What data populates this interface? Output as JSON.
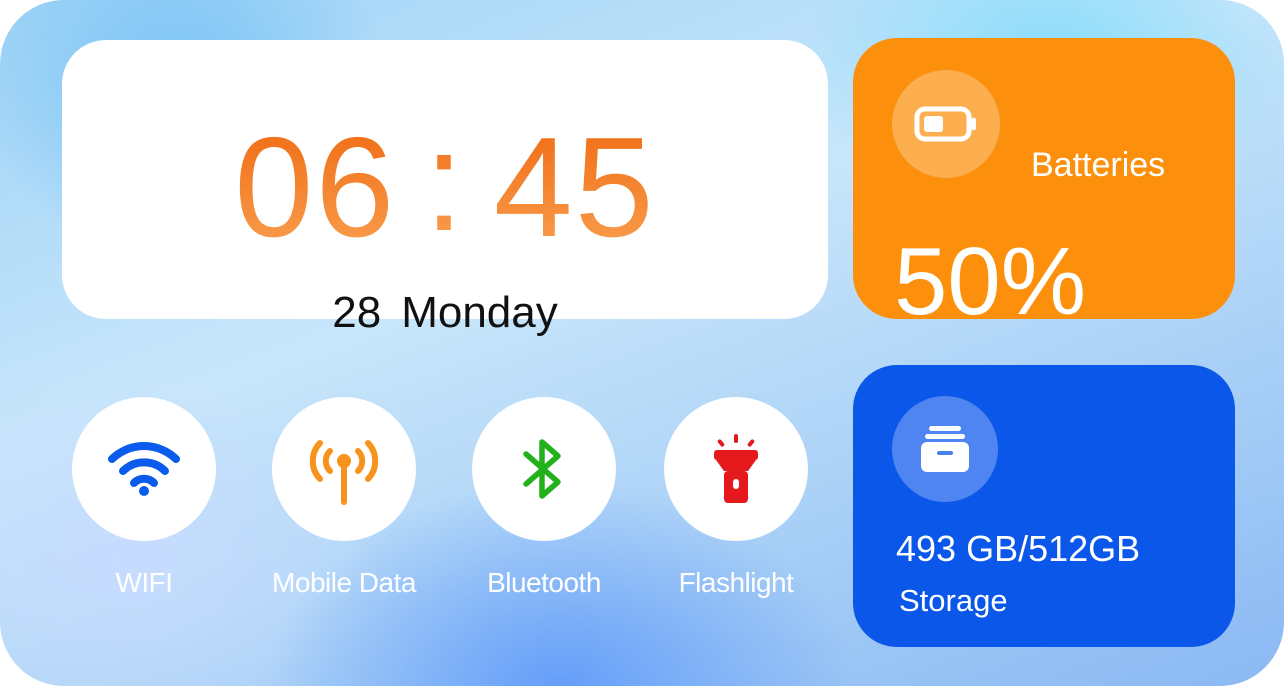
{
  "clock": {
    "hours": "06",
    "separator": ":",
    "minutes": "45",
    "day": "28",
    "weekday": "Monday"
  },
  "battery": {
    "label": "Batteries",
    "value": "50%",
    "level": 0.5,
    "icon": "battery-icon",
    "color": "#fc8f0c"
  },
  "storage": {
    "value": "493 GB/512GB",
    "label": "Storage",
    "icon": "storage-box-icon",
    "color": "#0a57ea"
  },
  "toggles": [
    {
      "label": "WIFI",
      "icon": "wifi-icon",
      "color": "#0b5bed"
    },
    {
      "label": "Mobile Data",
      "icon": "cell-tower-icon",
      "color": "#f7931c"
    },
    {
      "label": "Bluetooth",
      "icon": "bluetooth-icon",
      "color": "#22b11a"
    },
    {
      "label": "Flashlight",
      "icon": "flashlight-icon",
      "color": "#e5191b"
    }
  ],
  "accent": {
    "clock_orange": "#f37a1c"
  }
}
